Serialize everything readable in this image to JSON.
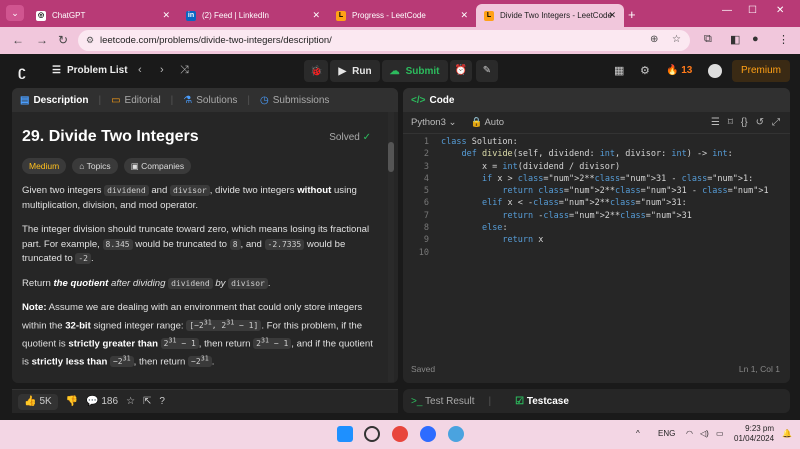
{
  "browser": {
    "tabs": [
      {
        "title": "ChatGPT",
        "active": false
      },
      {
        "title": "(2) Feed | LinkedIn",
        "active": false
      },
      {
        "title": "Progress - LeetCode",
        "active": false
      },
      {
        "title": "Divide Two Integers - LeetCode",
        "active": true
      }
    ],
    "url": "leetcode.com/problems/divide-two-integers/description/"
  },
  "nav": {
    "problem_list": "Problem List",
    "run": "Run",
    "submit": "Submit",
    "streak": "13",
    "premium": "Premium"
  },
  "left_panel": {
    "tabs": [
      "Description",
      "Editorial",
      "Solutions",
      "Submissions"
    ],
    "title": "29. Divide Two Integers",
    "solved": "Solved",
    "difficulty": "Medium",
    "topics": "Topics",
    "companies": "Companies",
    "likes": "5K",
    "comments": "186"
  },
  "code_panel": {
    "header": "Code",
    "language": "Python3",
    "auto": "Auto",
    "status": "Saved",
    "cursor": "Ln 1, Col 1",
    "lines": [
      "class Solution:",
      "    def divide(self, dividend: int, divisor: int) -> int:",
      "        x = int(dividend / divisor)",
      "        if x > 2**31 - 1:",
      "            return 2**31 - 1",
      "        elif x < -2**31:",
      "            return -2**31",
      "        else:",
      "            return x",
      ""
    ]
  },
  "test_panel": {
    "tabs": [
      "Test Result",
      "Testcase"
    ]
  },
  "taskbar": {
    "lang": "ENG",
    "time": "9:23 pm",
    "date": "01/04/2024"
  },
  "colors": {
    "accent_green": "#2cbb5d",
    "medium": "#ffc01e",
    "premium": "#ffa116",
    "browser_frame": "#b83a76"
  }
}
